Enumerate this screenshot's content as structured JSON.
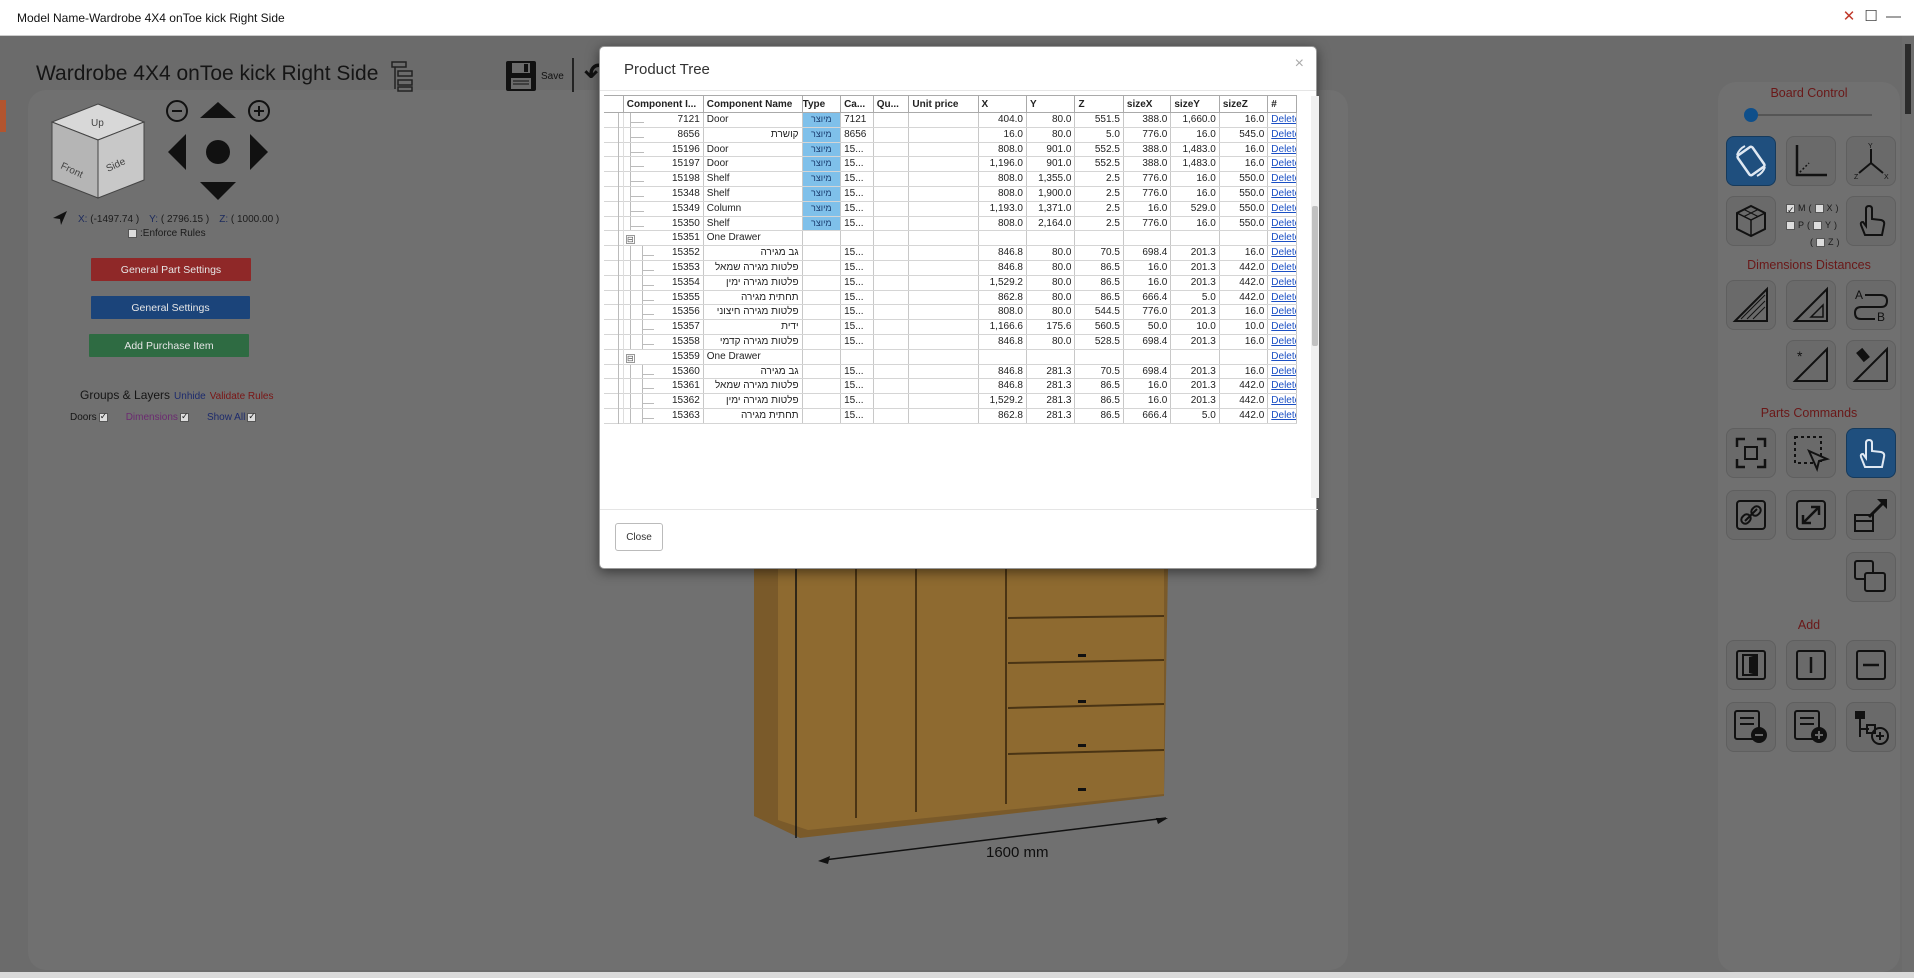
{
  "window": {
    "title": "Model Name-Wardrobe 4X4 onToe kick Right Side"
  },
  "toolbar": {
    "model_title": "Wardrobe 4X4 onToe kick Right Side",
    "save_label": "Save"
  },
  "view_cube": {
    "up": "Up",
    "front": "Front",
    "side": "Side"
  },
  "coords": {
    "x_label": "X:",
    "x_value": "(-1497.74 )",
    "y_label": "Y:",
    "y_value": "( 2796.15 )",
    "z_label": "Z:",
    "z_value": "( 1000.00 )"
  },
  "enforce_rules": {
    "label": ":Enforce Rules",
    "checked": false
  },
  "left_buttons": {
    "general_part_settings": "General Part Settings",
    "general_settings": "General Settings",
    "add_purchase_item": "Add Purchase Item"
  },
  "groups": {
    "title": "Groups & Layers",
    "unhide": "Unhide",
    "validate": "Validate Rules",
    "layers": [
      {
        "label": "Doors",
        "checked": true
      },
      {
        "label": "Dimensions",
        "checked": true
      },
      {
        "label": "Show All",
        "checked": true
      }
    ]
  },
  "dimension_label": "1600 mm",
  "right_panel": {
    "board_control": "Board Control",
    "dimensions_distances": "Dimensions Distances",
    "parts_commands": "Parts Commands",
    "add": "Add",
    "mpz": [
      {
        "label": "M",
        "axis": "X",
        "checked": true
      },
      {
        "label": "P",
        "axis": "Y",
        "checked": false
      },
      {
        "label": "",
        "axis": "Z",
        "checked": false
      }
    ]
  },
  "modal": {
    "title": "Product Tree",
    "close_label": "Close",
    "columns": [
      "Component I...",
      "Component Name",
      "Type",
      "Ca...",
      "Qu...",
      "Unit price",
      "X",
      "Y",
      "Z",
      "sizeX",
      "sizeY",
      "sizeZ",
      "#"
    ],
    "delete_label": "Delete",
    "rows": [
      {
        "level": 1,
        "id": "7121",
        "name": "Door",
        "type": "מיוצר",
        "cat": "7121",
        "x": "404.0",
        "y": "80.0",
        "z": "551.5",
        "sx": "388.0",
        "sy": "1,660.0",
        "sz": "16.0"
      },
      {
        "level": 1,
        "id": "8656",
        "name": "קושרת",
        "rtl": true,
        "type": "מיוצר",
        "cat": "8656",
        "x": "16.0",
        "y": "80.0",
        "z": "5.0",
        "sx": "776.0",
        "sy": "16.0",
        "sz": "545.0"
      },
      {
        "level": 1,
        "id": "15196",
        "name": "Door",
        "type": "מיוצר",
        "cat": "15...",
        "x": "808.0",
        "y": "901.0",
        "z": "552.5",
        "sx": "388.0",
        "sy": "1,483.0",
        "sz": "16.0"
      },
      {
        "level": 1,
        "id": "15197",
        "name": "Door",
        "type": "מיוצר",
        "cat": "15...",
        "x": "1,196.0",
        "y": "901.0",
        "z": "552.5",
        "sx": "388.0",
        "sy": "1,483.0",
        "sz": "16.0"
      },
      {
        "level": 1,
        "id": "15198",
        "name": "Shelf",
        "type": "מיוצר",
        "cat": "15...",
        "x": "808.0",
        "y": "1,355.0",
        "z": "2.5",
        "sx": "776.0",
        "sy": "16.0",
        "sz": "550.0"
      },
      {
        "level": 1,
        "id": "15348",
        "name": "Shelf",
        "type": "מיוצר",
        "cat": "15...",
        "x": "808.0",
        "y": "1,900.0",
        "z": "2.5",
        "sx": "776.0",
        "sy": "16.0",
        "sz": "550.0"
      },
      {
        "level": 1,
        "id": "15349",
        "name": "Column",
        "type": "מיוצר",
        "cat": "15...",
        "x": "1,193.0",
        "y": "1,371.0",
        "z": "2.5",
        "sx": "16.0",
        "sy": "529.0",
        "sz": "550.0"
      },
      {
        "level": 1,
        "id": "15350",
        "name": "Shelf",
        "type": "מיוצר",
        "cat": "15...",
        "x": "808.0",
        "y": "2,164.0",
        "z": "2.5",
        "sx": "776.0",
        "sy": "16.0",
        "sz": "550.0"
      },
      {
        "level": 1,
        "id": "15351",
        "name": "One Drawer",
        "group": true,
        "type": "",
        "cat": "",
        "x": "",
        "y": "",
        "z": "",
        "sx": "",
        "sy": "",
        "sz": ""
      },
      {
        "level": 2,
        "id": "15352",
        "name": "גב מגירה",
        "rtl": true,
        "type": "",
        "cat": "15...",
        "x": "846.8",
        "y": "80.0",
        "z": "70.5",
        "sx": "698.4",
        "sy": "201.3",
        "sz": "16.0"
      },
      {
        "level": 2,
        "id": "15353",
        "name": "פלטות מגירה שמאל",
        "rtl": true,
        "type": "",
        "cat": "15...",
        "x": "846.8",
        "y": "80.0",
        "z": "86.5",
        "sx": "16.0",
        "sy": "201.3",
        "sz": "442.0"
      },
      {
        "level": 2,
        "id": "15354",
        "name": "פלטות מגירה ימין",
        "rtl": true,
        "type": "",
        "cat": "15...",
        "x": "1,529.2",
        "y": "80.0",
        "z": "86.5",
        "sx": "16.0",
        "sy": "201.3",
        "sz": "442.0"
      },
      {
        "level": 2,
        "id": "15355",
        "name": "תחתית מגירה",
        "rtl": true,
        "type": "",
        "cat": "15...",
        "x": "862.8",
        "y": "80.0",
        "z": "86.5",
        "sx": "666.4",
        "sy": "5.0",
        "sz": "442.0"
      },
      {
        "level": 2,
        "id": "15356",
        "name": "פלטות מגירה חיצוני",
        "rtl": true,
        "type": "",
        "cat": "15...",
        "x": "808.0",
        "y": "80.0",
        "z": "544.5",
        "sx": "776.0",
        "sy": "201.3",
        "sz": "16.0"
      },
      {
        "level": 2,
        "id": "15357",
        "name": "ידית",
        "rtl": true,
        "type": "",
        "cat": "15...",
        "x": "1,166.6",
        "y": "175.6",
        "z": "560.5",
        "sx": "50.0",
        "sy": "10.0",
        "sz": "10.0"
      },
      {
        "level": 2,
        "id": "15358",
        "name": "פלטות מגירה קדמי",
        "rtl": true,
        "type": "",
        "cat": "15...",
        "x": "846.8",
        "y": "80.0",
        "z": "528.5",
        "sx": "698.4",
        "sy": "201.3",
        "sz": "16.0"
      },
      {
        "level": 1,
        "id": "15359",
        "name": "One Drawer",
        "group": true,
        "type": "",
        "cat": "",
        "x": "",
        "y": "",
        "z": "",
        "sx": "",
        "sy": "",
        "sz": ""
      },
      {
        "level": 2,
        "id": "15360",
        "name": "גב מגירה",
        "rtl": true,
        "type": "",
        "cat": "15...",
        "x": "846.8",
        "y": "281.3",
        "z": "70.5",
        "sx": "698.4",
        "sy": "201.3",
        "sz": "16.0"
      },
      {
        "level": 2,
        "id": "15361",
        "name": "פלטות מגירה שמאל",
        "rtl": true,
        "type": "",
        "cat": "15...",
        "x": "846.8",
        "y": "281.3",
        "z": "86.5",
        "sx": "16.0",
        "sy": "201.3",
        "sz": "442.0"
      },
      {
        "level": 2,
        "id": "15362",
        "name": "פלטות מגירה ימין",
        "rtl": true,
        "type": "",
        "cat": "15...",
        "x": "1,529.2",
        "y": "281.3",
        "z": "86.5",
        "sx": "16.0",
        "sy": "201.3",
        "sz": "442.0"
      },
      {
        "level": 2,
        "id": "15363",
        "name": "תחתית מגירה",
        "rtl": true,
        "type": "",
        "cat": "15...",
        "x": "862.8",
        "y": "281.3",
        "z": "86.5",
        "sx": "666.4",
        "sy": "5.0",
        "sz": "442.0"
      }
    ]
  }
}
